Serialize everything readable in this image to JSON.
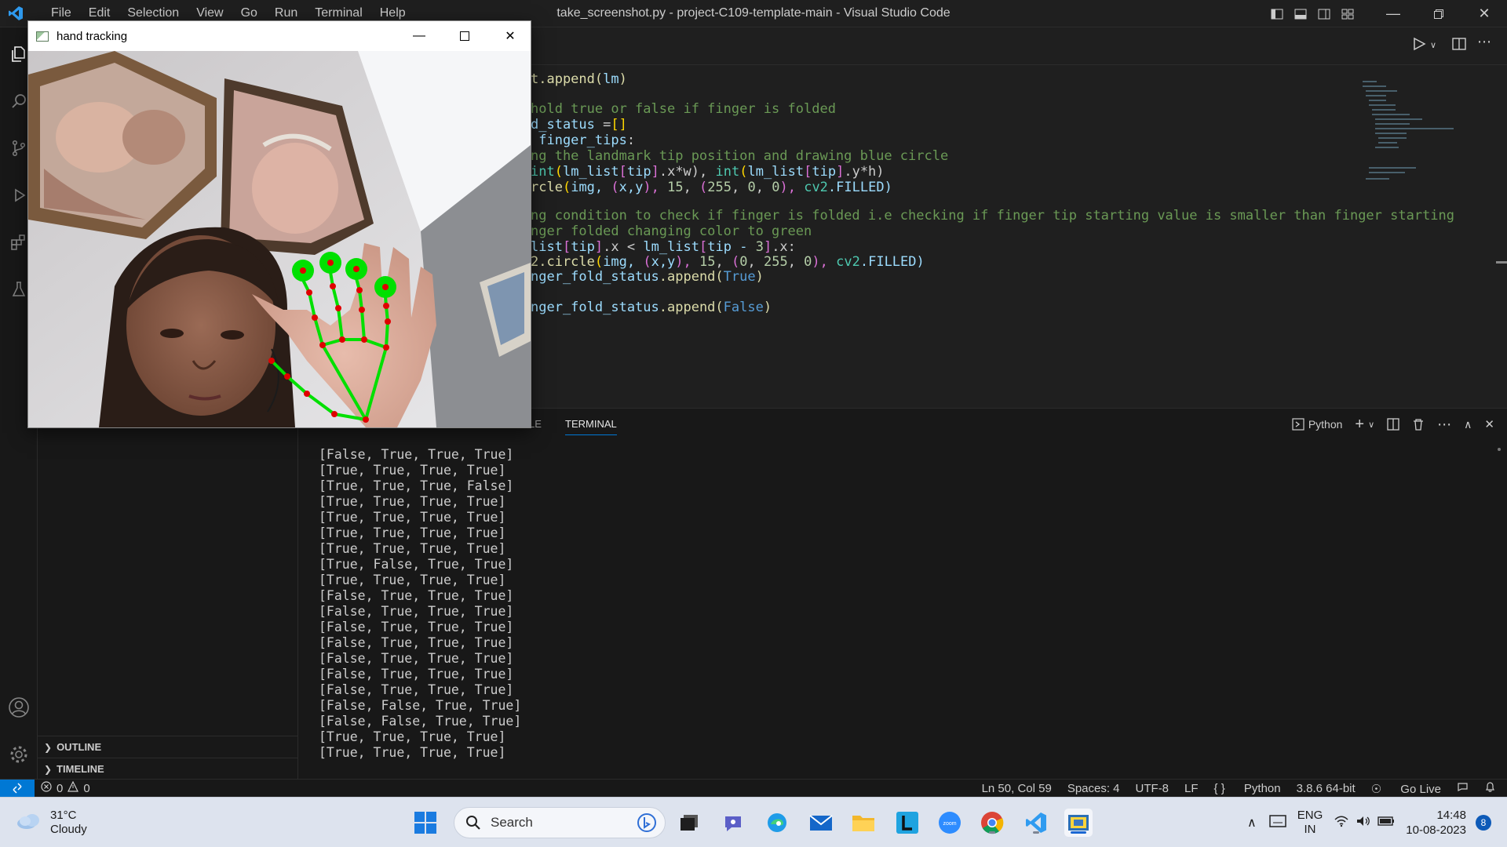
{
  "window": {
    "title": "take_screenshot.py - project-C109-template-main - Visual Studio Code",
    "menu": [
      "File",
      "Edit",
      "Selection",
      "View",
      "Go",
      "Run",
      "Terminal",
      "Help"
    ]
  },
  "editor": {
    "lines": [
      {
        "parts": [
          [
            "t.append(",
            "c-fn"
          ],
          [
            "lm",
            "c-var"
          ],
          [
            ")",
            "c-fn"
          ]
        ]
      },
      {
        "parts": [
          [
            "",
            ""
          ]
        ]
      },
      {
        "parts": [
          [
            "hold true or false if finger is folded",
            "c-com"
          ]
        ]
      },
      {
        "parts": [
          [
            "d_status ",
            "c-var"
          ],
          [
            "=",
            ""
          ],
          [
            "[]",
            "c-br"
          ]
        ]
      },
      {
        "parts": [
          [
            " finger_tips",
            "c-var"
          ],
          [
            ":",
            ""
          ]
        ]
      },
      {
        "parts": [
          [
            "ng the landmark tip position and drawing blue circle",
            "c-com"
          ]
        ]
      },
      {
        "parts": [
          [
            "int",
            "c-cls"
          ],
          [
            "(",
            "c-br"
          ],
          [
            "lm_list",
            "c-var"
          ],
          [
            "[",
            "c-br2"
          ],
          [
            "tip",
            "c-var"
          ],
          [
            "]",
            "c-br2"
          ],
          [
            ".x*w), ",
            ""
          ],
          [
            "int",
            "c-cls"
          ],
          [
            "(",
            "c-br"
          ],
          [
            "lm_list",
            "c-var"
          ],
          [
            "[",
            "c-br2"
          ],
          [
            "tip",
            "c-var"
          ],
          [
            "]",
            "c-br2"
          ],
          [
            ".y*h)",
            ""
          ]
        ]
      },
      {
        "parts": [
          [
            "rcle",
            "c-fn"
          ],
          [
            "(",
            "c-br"
          ],
          [
            "img, ",
            "c-var"
          ],
          [
            "(",
            "c-br2"
          ],
          [
            "x,y",
            "c-var"
          ],
          [
            "), ",
            "c-br2"
          ],
          [
            "15",
            "c-num"
          ],
          [
            ", ",
            ""
          ],
          [
            "(",
            "c-br2"
          ],
          [
            "255",
            "c-num"
          ],
          [
            ", ",
            ""
          ],
          [
            "0",
            "c-num"
          ],
          [
            ", ",
            ""
          ],
          [
            "0",
            "c-num"
          ],
          [
            "), ",
            "c-br2"
          ],
          [
            "cv2",
            "c-cls"
          ],
          [
            ".FILLED)",
            "c-var"
          ]
        ]
      },
      {
        "parts": [
          [
            "",
            ""
          ]
        ]
      },
      {
        "parts": [
          [
            "ng condition to check if finger is folded i.e checking if finger tip starting value is smaller than finger starting",
            "c-com"
          ]
        ]
      },
      {
        "parts": [
          [
            "nger folded changing color to green",
            "c-com"
          ]
        ]
      },
      {
        "parts": [
          [
            "list",
            "c-var"
          ],
          [
            "[",
            "c-br2"
          ],
          [
            "tip",
            "c-var"
          ],
          [
            "]",
            "c-br2"
          ],
          [
            ".x < ",
            ""
          ],
          [
            "lm_list",
            "c-var"
          ],
          [
            "[",
            "c-br2"
          ],
          [
            "tip - ",
            "c-var"
          ],
          [
            "3",
            "c-num"
          ],
          [
            "]",
            "c-br2"
          ],
          [
            ".x:",
            ""
          ]
        ]
      },
      {
        "parts": [
          [
            "2.circle",
            "c-fn"
          ],
          [
            "(",
            "c-br"
          ],
          [
            "img, ",
            "c-var"
          ],
          [
            "(",
            "c-br2"
          ],
          [
            "x,y",
            "c-var"
          ],
          [
            "), ",
            "c-br2"
          ],
          [
            "15",
            "c-num"
          ],
          [
            ", ",
            ""
          ],
          [
            "(",
            "c-br2"
          ],
          [
            "0",
            "c-num"
          ],
          [
            ", ",
            ""
          ],
          [
            "255",
            "c-num"
          ],
          [
            ", ",
            ""
          ],
          [
            "0",
            "c-num"
          ],
          [
            "), ",
            "c-br2"
          ],
          [
            "cv2",
            "c-cls"
          ],
          [
            ".FILLED)",
            "c-var"
          ]
        ]
      },
      {
        "parts": [
          [
            "nger_fold_status",
            "c-var"
          ],
          [
            ".append(",
            "c-fn"
          ],
          [
            "True",
            "c-kw"
          ],
          [
            ")",
            "c-fn"
          ]
        ]
      },
      {
        "parts": [
          [
            "",
            ""
          ]
        ]
      },
      {
        "parts": [
          [
            "nger_fold_status",
            "c-var"
          ],
          [
            ".append(",
            "c-fn"
          ],
          [
            "False",
            "c-kw"
          ],
          [
            ")",
            "c-fn"
          ]
        ]
      }
    ]
  },
  "panel": {
    "tabs": [
      {
        "label": "LE",
        "active": false
      },
      {
        "label": "TERMINAL",
        "active": true
      }
    ],
    "shell_label": "Python",
    "output": [
      "[False, True, True, True]",
      "[True, True, True, True]",
      "[True, True, True, False]",
      "[True, True, True, True]",
      "[True, True, True, True]",
      "[True, True, True, True]",
      "[True, True, True, True]",
      "[True, False, True, True]",
      "[True, True, True, True]",
      "[False, True, True, True]",
      "[False, True, True, True]",
      "[False, True, True, True]",
      "[False, True, True, True]",
      "[False, True, True, True]",
      "[False, True, True, True]",
      "[False, True, True, True]",
      "[False, False, True, True]",
      "[False, False, True, True]",
      "[True, True, True, True]",
      "[True, True, True, True]"
    ]
  },
  "sidebar": {
    "outline": "OUTLINE",
    "timeline": "TIMELINE"
  },
  "statusbar": {
    "errors": "0",
    "warnings": "0",
    "position": "Ln 50, Col 59",
    "spaces": "Spaces: 4",
    "encoding": "UTF-8",
    "eol": "LF",
    "language": "Python",
    "interpreter": "3.8.6 64-bit",
    "golive": "Go Live"
  },
  "taskbar": {
    "temp": "31°C",
    "condition": "Cloudy",
    "search_placeholder": "Search",
    "lang_top": "ENG",
    "lang_bottom": "IN",
    "time": "14:48",
    "date": "10-08-2023",
    "notifications": "8"
  },
  "hand_window": {
    "title": "hand tracking"
  },
  "colors": {
    "accent": "#0078d4",
    "landmark_line": "#00e000",
    "landmark_point": "#e00000"
  }
}
